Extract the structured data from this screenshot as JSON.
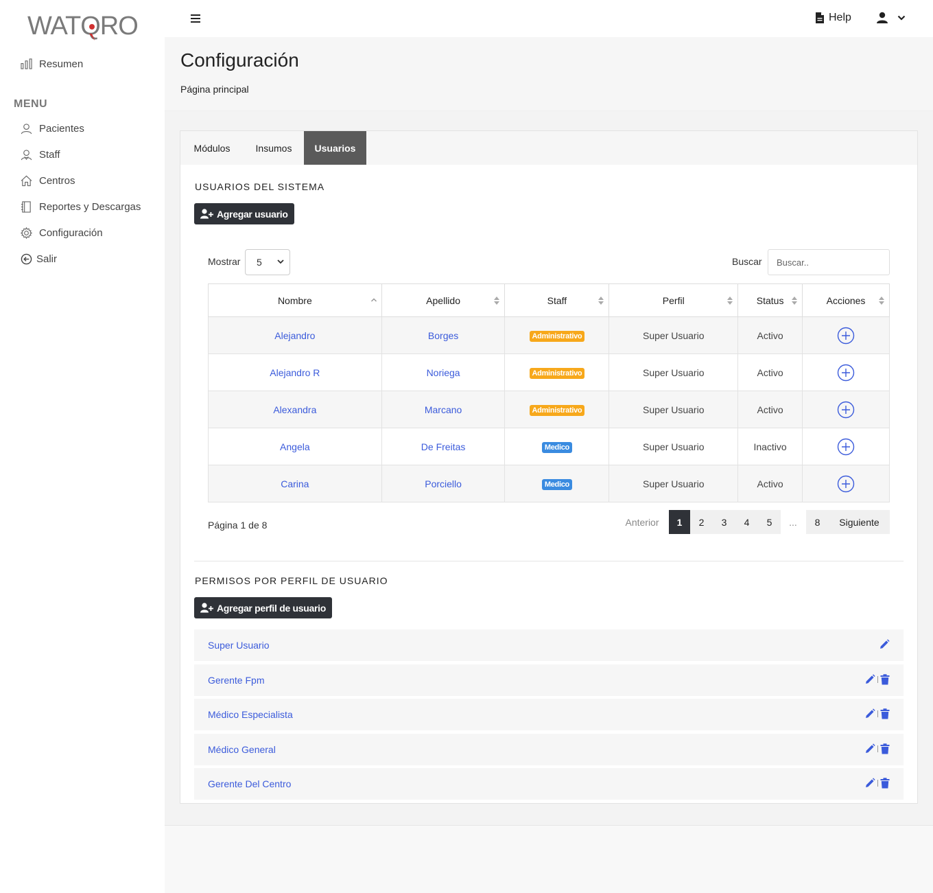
{
  "app": {
    "logo_text": "WATQRO"
  },
  "sidebar": {
    "summary": "Resumen",
    "menu_label": "MENU",
    "items": [
      {
        "label": "Pacientes",
        "icon": "user-icon"
      },
      {
        "label": "Staff",
        "icon": "staff-icon"
      },
      {
        "label": "Centros",
        "icon": "home-icon"
      },
      {
        "label": "Reportes y Descargas",
        "icon": "notebook-icon"
      },
      {
        "label": "Configuración",
        "icon": "gear-icon"
      },
      {
        "label": "Salir",
        "icon": "logout-icon"
      }
    ]
  },
  "topbar": {
    "help": "Help"
  },
  "header": {
    "title": "Configuración",
    "breadcrumb": "Página principal"
  },
  "tabs": [
    "Módulos",
    "Insumos",
    "Usuarios"
  ],
  "users_section": {
    "title": "USUARIOS DEL SISTEMA",
    "add_button": "Agregar usuario",
    "show_label": "Mostrar",
    "show_value": "5",
    "search_label": "Buscar",
    "search_placeholder": "Buscar..",
    "columns": [
      "Nombre",
      "Apellido",
      "Staff",
      "Perfil",
      "Status",
      "Acciones"
    ],
    "rows": [
      {
        "nombre": "Alejandro",
        "apellido": "Borges",
        "staff": "Administrativo",
        "perfil": "Super Usuario",
        "status": "Activo"
      },
      {
        "nombre": "Alejandro R",
        "apellido": "Noriega",
        "staff": "Administrativo",
        "perfil": "Super Usuario",
        "status": "Activo"
      },
      {
        "nombre": "Alexandra",
        "apellido": "Marcano",
        "staff": "Administrativo",
        "perfil": "Super Usuario",
        "status": "Activo"
      },
      {
        "nombre": "Angela",
        "apellido": "De Freitas",
        "staff": "Medico",
        "perfil": "Super Usuario",
        "status": "Inactivo"
      },
      {
        "nombre": "Carina",
        "apellido": "Porciello",
        "staff": "Medico",
        "perfil": "Super Usuario",
        "status": "Activo"
      }
    ],
    "page_info": "Página 1 de 8",
    "pagination": {
      "prev": "Anterior",
      "pages": [
        "1",
        "2",
        "3",
        "4",
        "5"
      ],
      "ellipsis": "...",
      "last": "8",
      "next": "Siguiente"
    }
  },
  "permissions_section": {
    "title": "PERMISOS POR PERFIL DE USUARIO",
    "add_button": "Agregar perfil de usuario",
    "profiles": [
      {
        "name": "Super Usuario",
        "deletable": false
      },
      {
        "name": "Gerente Fpm",
        "deletable": true
      },
      {
        "name": "Médico Especialista",
        "deletable": true
      },
      {
        "name": "Médico General",
        "deletable": true
      },
      {
        "name": "Gerente Del Centro",
        "deletable": true
      }
    ]
  },
  "colors": {
    "accent_link": "#3b5bdb",
    "dark_button": "#2f3238",
    "badge_admin": "#f7a81b",
    "badge_medico": "#3a8be0",
    "active_tab": "#5a5a5a"
  }
}
